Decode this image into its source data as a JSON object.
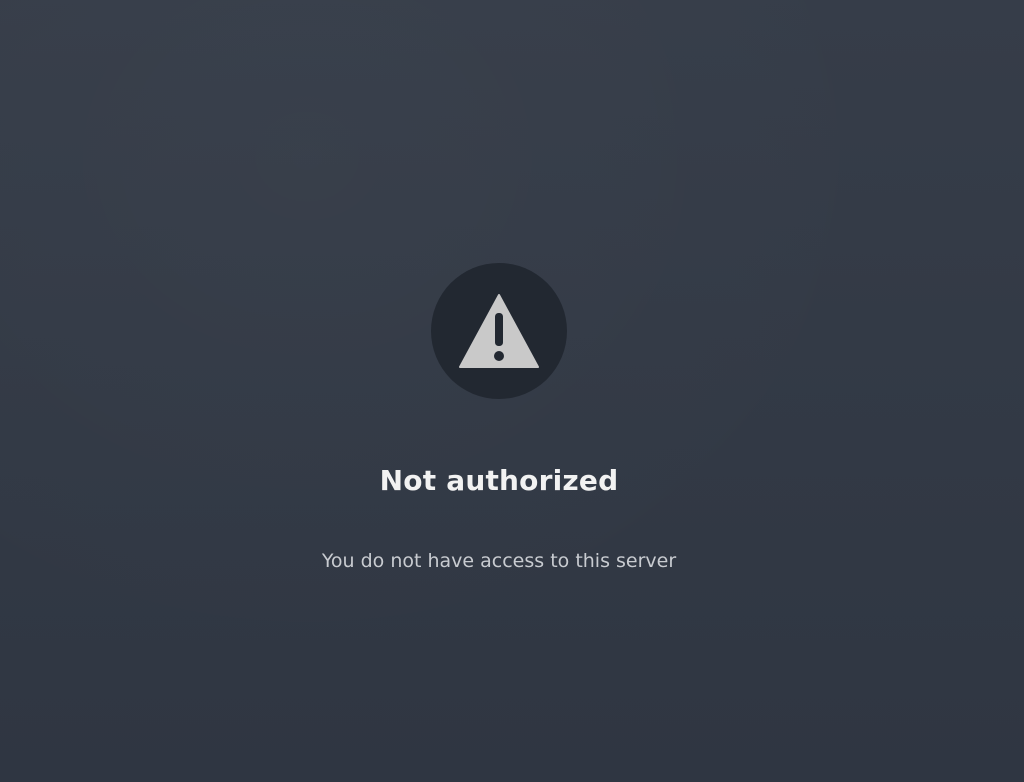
{
  "error": {
    "icon": "warning-triangle-icon",
    "title": "Not authorized",
    "message": "You do not have access to this server"
  },
  "colors": {
    "background": "#343b47",
    "icon_circle": "#222831",
    "icon_triangle": "#c9c9c9",
    "title_text": "#f2f2f2",
    "message_text": "#c8cbd0"
  }
}
